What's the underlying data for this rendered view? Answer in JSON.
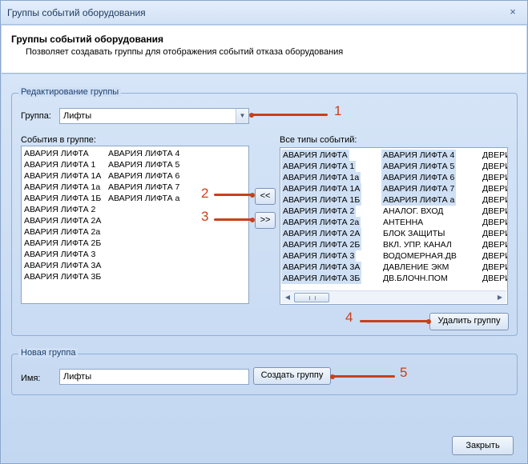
{
  "window": {
    "title": "Группы событий оборудования",
    "close_glyph": "×"
  },
  "header": {
    "title": "Группы событий оборудования",
    "subtitle": "Позволяет создавать группы для отображения событий отказа оборудования"
  },
  "edit_group": {
    "legend": "Редактирование группы",
    "group_label": "Группа:",
    "group_value": "Лифты",
    "events_in_group_label": "События в группе:",
    "events_in_group": [
      "АВАРИЯ ЛИФТА",
      "АВАРИЯ ЛИФТА 1",
      "АВАРИЯ ЛИФТА 1А",
      "АВАРИЯ ЛИФТА 1а",
      "АВАРИЯ ЛИФТА 1Б",
      "АВАРИЯ ЛИФТА 2",
      "АВАРИЯ ЛИФТА 2А",
      "АВАРИЯ ЛИФТА 2а",
      "АВАРИЯ ЛИФТА 2Б",
      "АВАРИЯ ЛИФТА 3",
      "АВАРИЯ ЛИФТА 3А",
      "АВАРИЯ ЛИФТА 3Б",
      "АВАРИЯ ЛИФТА 4",
      "АВАРИЯ ЛИФТА 5",
      "АВАРИЯ ЛИФТА 6",
      "АВАРИЯ ЛИФТА 7",
      "АВАРИЯ ЛИФТА а"
    ],
    "add_button": "<<",
    "remove_button": ">>",
    "all_types_label": "Все типы событий:",
    "all_types": {
      "col1": [
        "АВАРИЯ ЛИФТА",
        "АВАРИЯ ЛИФТА 1",
        "АВАРИЯ ЛИФТА 1а",
        "АВАРИЯ ЛИФТА 1А",
        "АВАРИЯ ЛИФТА 1Б",
        "АВАРИЯ ЛИФТА 2",
        "АВАРИЯ ЛИФТА 2а",
        "АВАРИЯ ЛИФТА 2А",
        "АВАРИЯ ЛИФТА 2Б",
        "АВАРИЯ ЛИФТА 3",
        "АВАРИЯ ЛИФТА 3А",
        "АВАРИЯ ЛИФТА 3Б"
      ],
      "col2": [
        "АВАРИЯ ЛИФТА 4",
        "АВАРИЯ ЛИФТА 5",
        "АВАРИЯ ЛИФТА 6",
        "АВАРИЯ ЛИФТА 7",
        "АВАРИЯ ЛИФТА а",
        "АНАЛОГ. ВХОД",
        "АНТЕННА",
        "БЛОК ЗАЩИТЫ",
        "ВКЛ. УПР. КАНАЛ",
        "ВОДОМЕРНАЯ.ДВ",
        "ДАВЛЕНИЕ ЭКМ",
        "ДВ.БЛОЧН.ПОМ"
      ],
      "col3": [
        "ДВЕРИ",
        "ДВЕРИ",
        "ДВЕРИ",
        "ДВЕРИ",
        "ДВЕРИ",
        "ДВЕРИ",
        "ДВЕРИ",
        "ДВЕРИ",
        "ДВЕРИ",
        "ДВЕРИ",
        "ДВЕРИ",
        "ДВЕРИ"
      ]
    },
    "delete_group_button": "Удалить группу"
  },
  "new_group": {
    "legend": "Новая группа",
    "name_label": "Имя:",
    "name_value": "Лифты",
    "create_button": "Создать группу"
  },
  "footer": {
    "close_button": "Закрыть"
  },
  "annotations": [
    "1",
    "2",
    "3",
    "4",
    "5"
  ],
  "colors": {
    "annotation": "#c8401a",
    "selection": "#cfe0f5"
  }
}
